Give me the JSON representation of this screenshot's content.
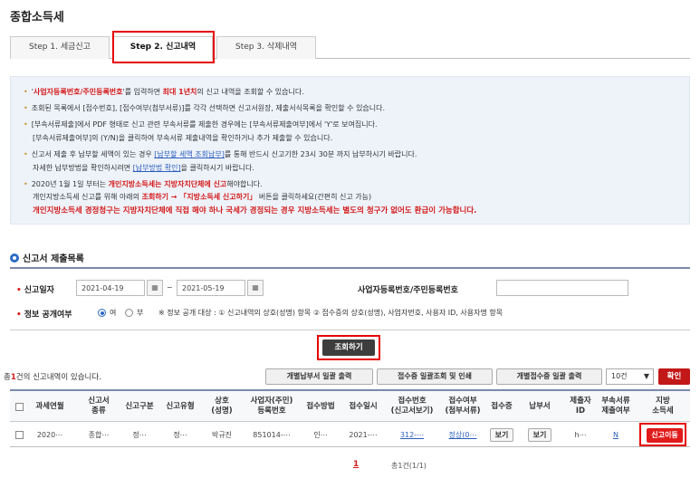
{
  "page_title": "종합소득세",
  "tabs": [
    {
      "label": "Step 1. 세금신고"
    },
    {
      "label": "Step 2. 신고내역"
    },
    {
      "label": "Step 3. 삭제내역"
    }
  ],
  "info": {
    "l1a": "'",
    "l1b": "사업자등록번호/주민등록번호",
    "l1c": "'를 입력하면 ",
    "l1d": "최대 1년치",
    "l1e": "의 신고 내역을 조회할 수 있습니다.",
    "l2": "조회된 목록에서 [접수번호], [접수여부(첨부서류)]를 각각 선택하면 신고서원장, 제출서식목록을 확인할 수 있습니다.",
    "l3": "[부속서류제출]에서 PDF 형태로 신고 관련 부속서류를 제출한 경우에는 [부속서류제출여부]에서 'Y'로 보여집니다.",
    "l4": "[부속서류제출여부]의 (Y/N)을 클릭하여 부속서류 제출내역을 확인하거나 추가 제출할 수 있습니다.",
    "l5a": "신고서 제출 후 납부할 세액이 있는 경우 ",
    "l5b": "[납부할 세액 조회납부]",
    "l5c": "를 통해 반드시 신고기한 23시 30분 까지 납부하시기 바랍니다.",
    "l6a": "자세한 납부방법을 확인하시려면 ",
    "l6b": "[납부방법 확인]",
    "l6c": "을 클릭하시기 바랍니다.",
    "l7a": "2020년 1월 1일 부터는 ",
    "l7b": "개인지방소득세는 지방자치단체에 신고",
    "l7c": "해야합니다.",
    "l8a": "개인지방소득세 신고를 위해 아래의 ",
    "l8b": "조회하기 → 「지방소득세 신고하기」",
    "l8c": " 버튼을 클릭하세요(간편히 신고 가능)",
    "l9": "개인지방소득세 경정청구는 지방자치단체에 직접 해야 하나 국세가 경정되는 경우 지방소득세는 별도의 청구가 없어도 환급이 가능합니다."
  },
  "section_title": "신고서 제출목록",
  "search": {
    "date_label": "신고일자",
    "date_from": "2021-04-19",
    "date_sep": "~",
    "date_to": "2021-05-19",
    "calendar_icon": "calendar-icon",
    "id_label": "사업자등록번호/주민등록번호",
    "disclosure_label": "정보 공개여부",
    "opt_yes": "여",
    "opt_no": "부",
    "disclosure_note": "※ 정보 공개 대상 : ① 신고내역의 상호(성명) 항목 ② 접수증의 상호(성명), 사업자번호, 사용자 ID, 사용자명 항목",
    "query_button": "조회하기"
  },
  "result": {
    "count_a": "총",
    "count_b": "1",
    "count_c": "건의 신고내역이 있습니다.",
    "btn_bulk_tax_print": "개별납부서 일괄 출력",
    "btn_receipt_bulk": "접수증 일괄조회 및 인쇄",
    "btn_bulk_receipt_print": "개별접수증 일괄 출력",
    "page_size": "10건",
    "confirm": "확인"
  },
  "table": {
    "headers": [
      "",
      "과세연월",
      "신고서\n종류",
      "신고구분",
      "신고유형",
      "상호\n(성명)",
      "사업자(주민)\n등록번호",
      "접수방법",
      "접수일시",
      "접수번호\n(신고서보기)",
      "접수여부\n(첨부서류)",
      "접수증",
      "납부서",
      "제출자\nID",
      "부속서류\n제출여부",
      "지방\n소득세"
    ],
    "row": {
      "period": "2020⋯",
      "form_type": "종합⋯",
      "category": "정⋯",
      "filing_type": "정⋯",
      "name": "박규진",
      "reg_no": "851014-⋯",
      "method": "인⋯",
      "datetime": "2021-⋯",
      "receipt_no": "312-⋯",
      "status": "정상(0⋯",
      "receipt_btn": "보기",
      "tax_btn": "보기",
      "submitter": "h⋯",
      "attach": "N",
      "local_tax_btn": "신고이동"
    }
  },
  "pager": {
    "current": "1",
    "info": "총1건(1/1)"
  }
}
